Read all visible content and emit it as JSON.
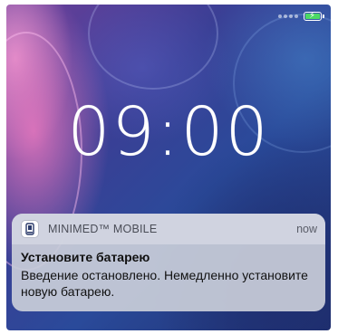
{
  "status_bar": {
    "signal_icon": "signal-dots-icon",
    "battery_icon": "battery-charging-icon",
    "battery_level": 1.0,
    "battery_color": "#4cd964"
  },
  "lock_screen": {
    "time": "09:00"
  },
  "notification": {
    "app_icon": "minimed-app-icon",
    "app_name": "MINIMED™ MOBILE",
    "time": "now",
    "title": "Установите батарею",
    "body": "Введение остановлено. Немедленно установите новую батарею."
  }
}
